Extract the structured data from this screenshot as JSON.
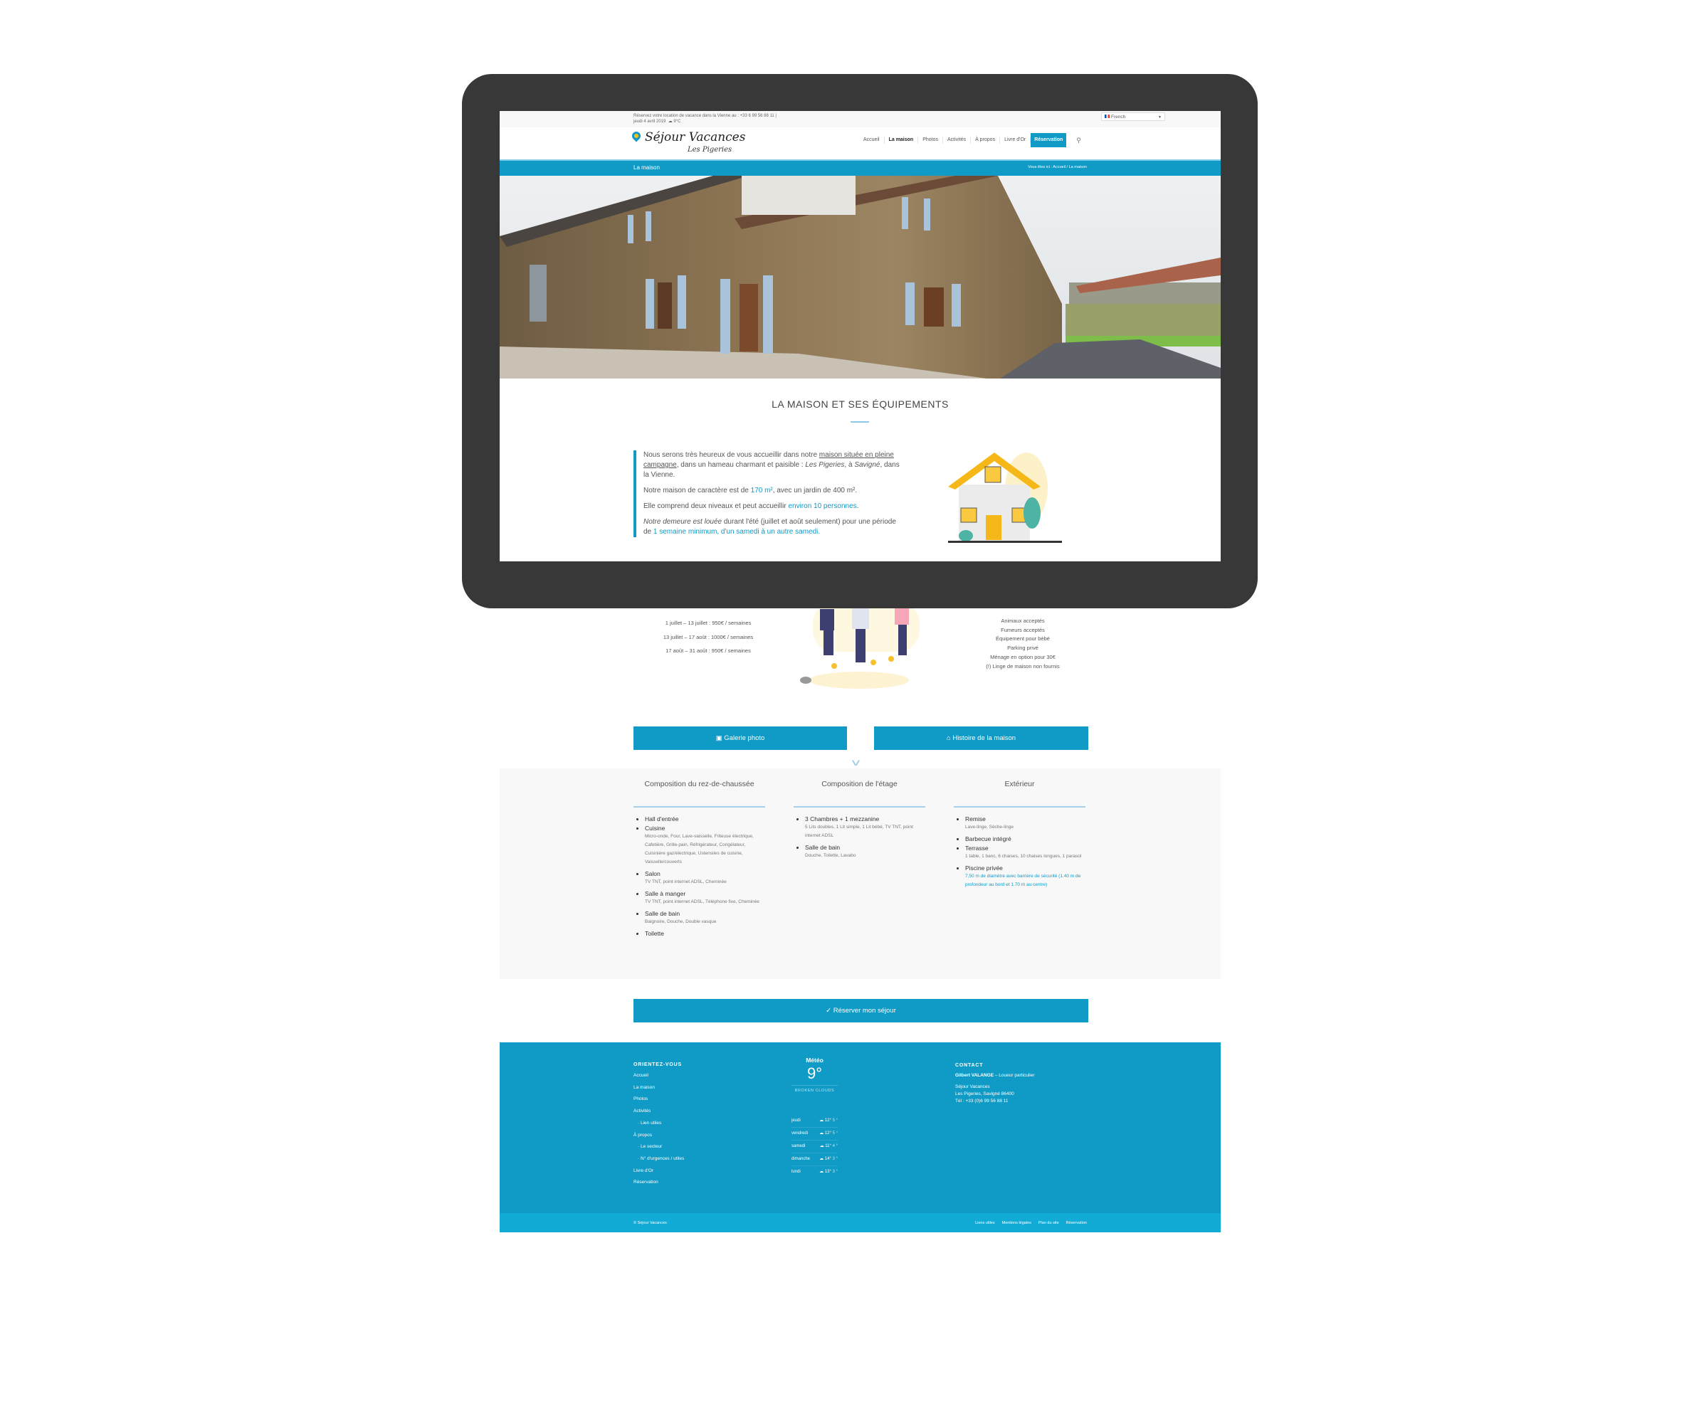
{
  "colors": {
    "accent": "#109ac6",
    "footer": "#0f9bc6",
    "footer_bottom": "#12abd6",
    "bezel": "#383838",
    "logo_yellow": "#f3c21a"
  },
  "topbar": {
    "line1": "Réservez votre location de vacance dans la Vienne au : +33 6 99 56 88 11 |",
    "line2": "jeudi 4 avril 2019",
    "weather": "9°C",
    "weather_icon": "cloud-icon",
    "language": "French"
  },
  "logo": {
    "title": "Séjour Vacances",
    "subtitle": "Les Pigeries"
  },
  "nav": {
    "items": [
      {
        "label": "Accueil"
      },
      {
        "label": "La maison",
        "active": true
      },
      {
        "label": "Photos"
      },
      {
        "label": "Activités"
      },
      {
        "label": "À propos"
      },
      {
        "label": "Livre d'Or"
      }
    ],
    "cta": "Réservation",
    "search_icon": "search-icon"
  },
  "titlebar": {
    "title": "La maison",
    "breadcrumb_prefix": "Vous êtes ici :",
    "crumbs": [
      "Accueil",
      "La maison"
    ]
  },
  "section": {
    "title": "LA MAISON ET SES ÉQUIPEMENTS"
  },
  "intro": {
    "p1a": "Nous serons très heureux de vous accueillir dans notre ",
    "p1link": "maison située en pleine campagne",
    "p1b": ", dans un hameau charmant et paisible : ",
    "p1place": "Les Pigeries",
    "p1c": ", à ",
    "p1town": "Savigné",
    "p1d": ", dans la Vienne.",
    "p2a": "Notre maison de caractère est de ",
    "p2hl": "170 m²",
    "p2b": ", avec un jardin de 400 m².",
    "p3a": "Elle comprend deux niveaux et peut accueillir ",
    "p3hl": "environ 10 personnes",
    "p4i": "Notre demeure est louée",
    "p4a": " durant l'été (juillet et août seulement) pour une période de ",
    "p4hl": "1 semaine minimum, d'un samedi à un autre samedi."
  },
  "prices": [
    "1 juillet – 13 juillet : 950€ / semaines",
    "13 juillet – 17 août : 1000€ / semaines",
    "17 août – 31 août : 950€ / semaines"
  ],
  "amenities": [
    "Animaux acceptés",
    "Fumeurs acceptés",
    "Équipement pour bébé",
    "Parking privé",
    "Ménage en option pour 30€",
    "(!) Linge de maison non fournis"
  ],
  "buttons": {
    "gallery": "Galerie photo",
    "gallery_icon": "camera-icon",
    "history": "Histoire de la maison",
    "history_icon": "home-icon",
    "reserve": "✓ Réserver mon séjour"
  },
  "composition": [
    {
      "title": "Composition du rez-de-chaussée",
      "items": [
        {
          "name": "Hall d'entrée"
        },
        {
          "name": "Cuisine",
          "detail": "Micro-onde, Four, Lave-vaisselle, Friteuse électrique, Cafetière, Grille-pain, Réfrigérateur, Congélateur, Cuisinière gaz/électrique, Ustensiles de cuisine, Vaisselle/couverts"
        },
        {
          "name": "Salon",
          "detail": "TV TNT, point internet ADSL, Cheminée"
        },
        {
          "name": "Salle à manger",
          "detail": "TV TNT, point internet ADSL, Téléphone fixe, Cheminée"
        },
        {
          "name": "Salle de bain",
          "detail": "Baignoire, Douche, Double vasque"
        },
        {
          "name": "Toilette"
        }
      ]
    },
    {
      "title": "Composition de l'étage",
      "items": [
        {
          "name": "3 Chambres + 1 mezzanine",
          "detail": "5 Lits doubles, 1 Lit simple, 1 Lit bébé, TV TNT, point internet ADSL"
        },
        {
          "name": "Salle de bain",
          "detail": "Douche, Toilette, Lavabo"
        }
      ]
    },
    {
      "title": "Extérieur",
      "items": [
        {
          "name": "Remise",
          "detail": "Lave-linge, Sèche-linge"
        },
        {
          "name": "Barbecue intégré"
        },
        {
          "name": "Terrasse",
          "detail": "1 table, 1 banc, 6 chaises, 10 chaises longues, 1 parasol"
        },
        {
          "name": "Piscine privée",
          "detail": "7,50 m de diamètre avec barrière de sécurité (1.40 m de profondeur au bord et 1.70 m au centre)",
          "detail_highlight": true
        }
      ]
    }
  ],
  "footer": {
    "nav_title": "ORIENTEZ-VOUS",
    "nav": [
      {
        "label": "Accueil"
      },
      {
        "label": "La maison"
      },
      {
        "label": "Photos"
      },
      {
        "label": "Activités"
      },
      {
        "label": "Lien utiles",
        "sub": true
      },
      {
        "label": "À propos"
      },
      {
        "label": "Le secteur",
        "sub": true
      },
      {
        "label": "N° d'urgences / utiles",
        "sub": true
      },
      {
        "label": "Livre d'Or"
      },
      {
        "label": "Réservation"
      }
    ],
    "meteo": {
      "title": "Météo",
      "temp": "9°",
      "desc": "BROKEN CLOUDS",
      "forecast": [
        {
          "day": "jeudi",
          "hi": "12°",
          "lo": "5 °"
        },
        {
          "day": "vendredi",
          "hi": "12°",
          "lo": "5 °"
        },
        {
          "day": "samedi",
          "hi": "11°",
          "lo": "4 °"
        },
        {
          "day": "dimanche",
          "hi": "14°",
          "lo": "3 °"
        },
        {
          "day": "lundi",
          "hi": "13°",
          "lo": "3 °"
        }
      ]
    },
    "contact": {
      "title": "CONTACT",
      "name": "Gilbert VALANGE",
      "role": " – Loueur particulier",
      "lines": [
        "Séjour Vacances",
        "Les Pigeries, Savigné 86400",
        "Tél : +33 (0)6 99 56 88 11"
      ]
    },
    "copyright": "© Séjour Vacances",
    "links": [
      "Liens utiles",
      "Mentions légales",
      "Plan du site",
      "Réservation"
    ]
  }
}
